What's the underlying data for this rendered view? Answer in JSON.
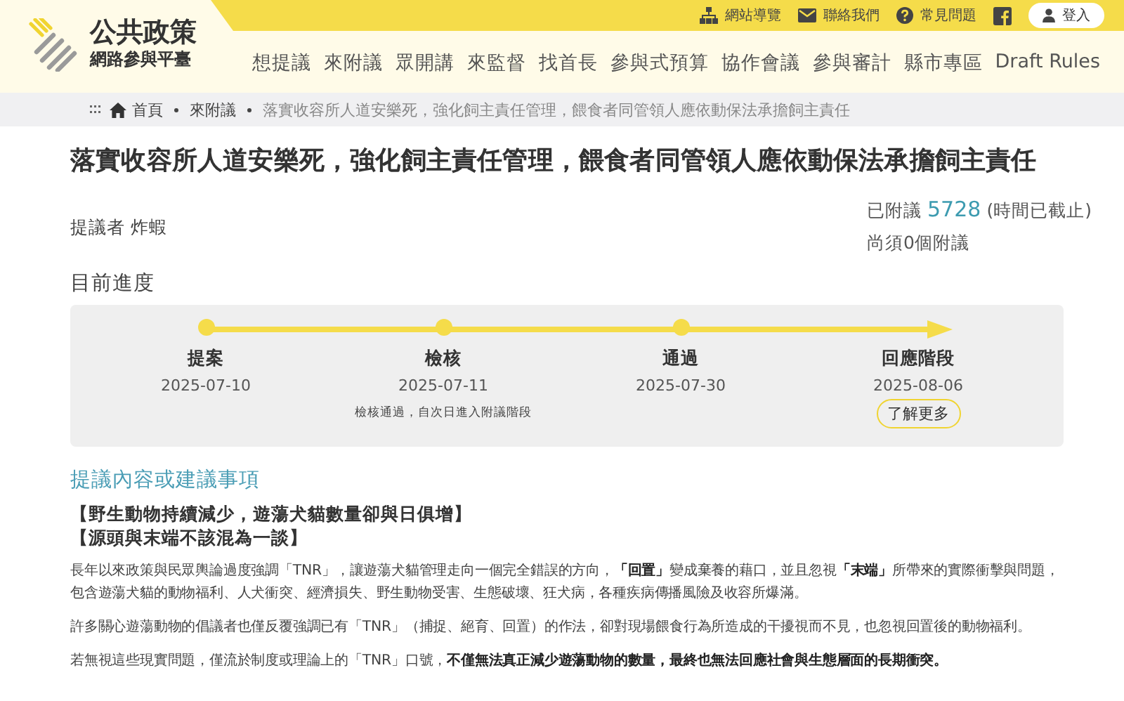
{
  "header": {
    "logo_title": "公共政策",
    "logo_subtitle": "網路參與平臺",
    "utility_links": [
      {
        "kind": "sitemap",
        "label": "網站導覽"
      },
      {
        "kind": "mail",
        "label": "聯絡我們"
      },
      {
        "kind": "help",
        "label": "常見問題"
      },
      {
        "kind": "facebook"
      }
    ],
    "login": "登入",
    "nav": [
      "想提議",
      "來附議",
      "眾開講",
      "來監督",
      "找首長",
      "參與式預算",
      "協作會議",
      "參與審計",
      "縣市專區",
      "Draft Rules"
    ]
  },
  "breadcrumb": [
    "首頁",
    "來附議",
    "落實收容所人道安樂死，強化飼主責任管理，餵食者同管領人應依動保法承擔飼主責任"
  ],
  "title": "落實收容所人道安樂死，強化飼主責任管理，餵食者同管領人應依動保法承擔飼主責任",
  "proposer": {
    "label": "提議者",
    "name": "炸蝦"
  },
  "endorsement": {
    "label": "已附議",
    "count": "5728",
    "note": "(時間已截止)",
    "remaining": "尚須0個附議"
  },
  "progress": {
    "title": "目前進度",
    "stages": [
      {
        "name": "提案",
        "date": "2025-07-10"
      },
      {
        "name": "檢核",
        "date": "2025-07-11",
        "note": "檢核通過，自次日進入附議階段"
      },
      {
        "name": "通過",
        "date": "2025-07-30"
      },
      {
        "name": "回應階段",
        "date": "2025-08-06",
        "link": "了解更多"
      }
    ]
  },
  "content": {
    "heading": "提議內容或建議事項",
    "highlights": [
      "【野生動物持續減少，遊蕩犬貓數量卻與日俱增】",
      "【源頭與末端不該混為一談】"
    ],
    "paragraphs": [
      "長年以來政策與民眾輿論過度強調「TNR」，讓遊蕩犬貓管理走向一個完全錯誤的方向，**「回置」**變成棄養的藉口，並且忽視**「末端」**所帶來的實際衝擊與問題，包含遊蕩犬貓的動物福利、人犬衝突、經濟損失、野生動物受害、生態破壞、狂犬病，各種疾病傳播風險及收容所爆滿。",
      "許多關心遊蕩動物的倡議者也僅反覆強調已有「TNR」（捕捉、絕育、回置）的作法，卻對現場餵食行為所造成的干擾視而不見，也忽視回置後的動物福利。",
      "若無視這些現實問題，僅流於制度或理論上的「TNR」口號，**不僅無法真正減少遊蕩動物的數量，最終也無法回應社會與生態層面的長期衝突。**"
    ]
  }
}
